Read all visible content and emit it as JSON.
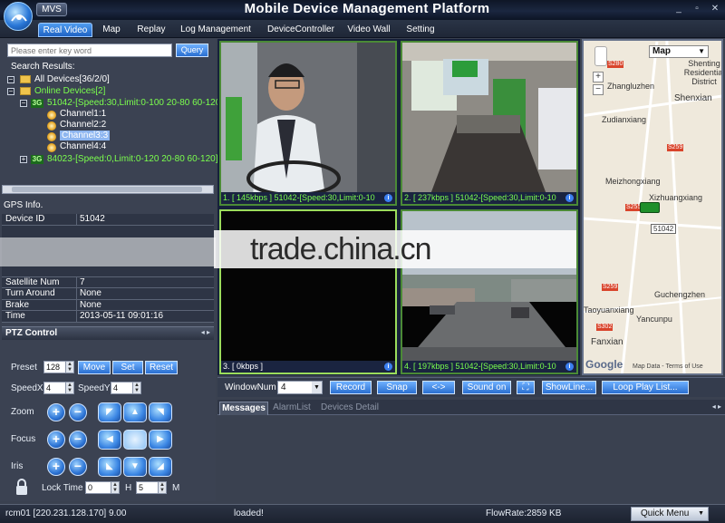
{
  "window": {
    "app_tab": "MVS",
    "title": "Mobile Device Management Platform",
    "minimize": "_",
    "restore": "▫",
    "close": "✕"
  },
  "nav": {
    "tabs": [
      "Real Video",
      "Map",
      "Replay",
      "Log Management",
      "DeviceController",
      "Video Wall",
      "Setting"
    ],
    "active": "Real Video"
  },
  "search": {
    "placeholder": "Please enter key word",
    "button": "Query",
    "results_label": "Search Results:"
  },
  "tree": {
    "all_devices": "All Devices[36/2/0]",
    "online_devices": "Online Devices[2]",
    "device1": "51042-[Speed:30,Limit:0-100 20-80 60-120]",
    "channels": [
      "Channel1:1",
      "Channel2:2",
      "Channel3:3",
      "Channel4:4"
    ],
    "device2": "84023-[Speed:0,Limit:0-120 20-80 60-120]",
    "badge": "3G"
  },
  "gps": {
    "title": "GPS Info.",
    "rows": [
      {
        "key": "Device ID",
        "value": "51042"
      },
      {
        "key": "Satellite Num",
        "value": "7"
      },
      {
        "key": "Turn Around",
        "value": "None"
      },
      {
        "key": "Brake",
        "value": "None"
      },
      {
        "key": "Time",
        "value": "2013-05-11 09:01:16"
      }
    ]
  },
  "ptz": {
    "title": "PTZ Control",
    "preset_label": "Preset",
    "preset_value": "128",
    "move": "Move",
    "set": "Set",
    "reset": "Reset",
    "speedx_label": "SpeedX",
    "speedx_value": "4",
    "speedy_label": "SpeedY",
    "speedy_value": "4",
    "zoom_label": "Zoom",
    "focus_label": "Focus",
    "iris_label": "Iris",
    "lock_time_label": "Lock Time",
    "lock_h_value": "0",
    "h_label": "H",
    "lock_m_value": "5",
    "m_label": "M",
    "plus": "+",
    "minus": "−"
  },
  "videos": [
    {
      "caption": "1. [ 145kbps ] 51042-[Speed:30,Limit:0-10"
    },
    {
      "caption": "2. [ 237kbps ] 51042-[Speed:30,Limit:0-10"
    },
    {
      "caption": "3. [ 0kbps ]"
    },
    {
      "caption": "4. [ 197kbps ] 51042-[Speed:30,Limit:0-10"
    }
  ],
  "map": {
    "type": "Map",
    "places": [
      "Shenting Residential District",
      "Shenxian",
      "Zhangluzhen",
      "Zudianxiang",
      "Meizhongxiang",
      "Xizhuangxiang",
      "Guchengzhen",
      "Taoyuanxiang",
      "Yancunpu",
      "Fanxian"
    ],
    "roads": [
      "S280",
      "S259",
      "S255",
      "S259",
      "S302"
    ],
    "marker_label": "51042",
    "logo": "Google",
    "footer": "Map Data - Terms of Use"
  },
  "toolbar": {
    "window_num_label": "WindowNum",
    "window_num_value": "4",
    "record": "Record",
    "snap": "Snap",
    "swap": "<->",
    "sound_on": "Sound on",
    "showline": "ShowLine...",
    "loop_play": "Loop Play List..."
  },
  "messages": {
    "tabs": [
      "Messages",
      "AlarmList",
      "Devices Detail"
    ]
  },
  "status": {
    "server": "rcm01 [220.231.128.170] 9.00",
    "loaded": "loaded!",
    "flow_rate": "FlowRate:2859 KB",
    "quick_menu": "Quick Menu"
  },
  "watermark": "trade.china.cn",
  "colors": {
    "accent_blue": "#2a6fd0",
    "online_green": "#7bff4d",
    "panel_bg": "#3b4252",
    "video_border": "#4b8a36"
  }
}
